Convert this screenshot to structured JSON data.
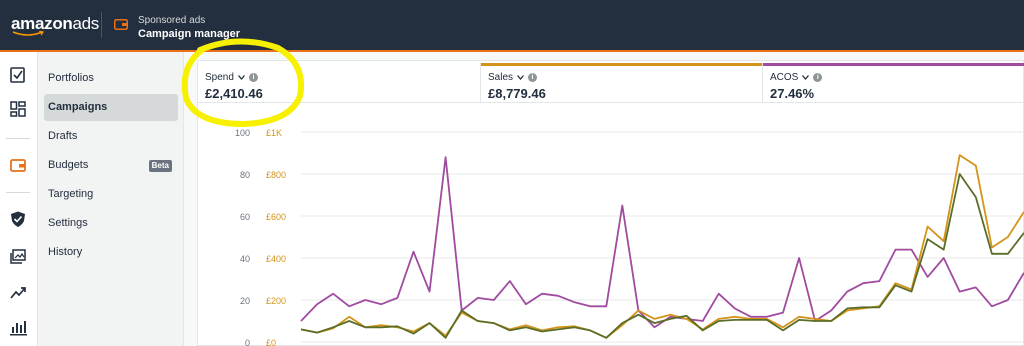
{
  "app": {
    "logo_main": "amazon",
    "logo_ads": "ads",
    "breadcrumb_top": "Sponsored ads",
    "breadcrumb_main": "Campaign manager"
  },
  "colors": {
    "topbar": "#232f3e",
    "accent": "#e8711a",
    "spend": "#5a6e28",
    "sales": "#d4931a",
    "acos": "#a04ba0",
    "highlight": "#f7f000"
  },
  "rail_icons": [
    "checklist-icon",
    "dashboard-icon",
    "wallet-icon",
    "shield-icon",
    "media-icon",
    "trend-icon",
    "bar-chart-icon"
  ],
  "sidebar": {
    "items": [
      {
        "label": "Portfolios",
        "active": false
      },
      {
        "label": "Campaigns",
        "active": true
      },
      {
        "label": "Drafts",
        "active": false
      },
      {
        "label": "Budgets",
        "active": false,
        "badge": "Beta"
      },
      {
        "label": "Targeting",
        "active": false
      },
      {
        "label": "Settings",
        "active": false
      },
      {
        "label": "History",
        "active": false
      }
    ]
  },
  "metrics": [
    {
      "label": "Spend",
      "value": "£2,410.46",
      "color": "#5a6e28"
    },
    {
      "label": "Sales",
      "value": "£8,779.46",
      "color": "#d4931a"
    },
    {
      "label": "ACOS",
      "value": "27.46%",
      "color": "#a04ba0"
    }
  ],
  "chart_data": {
    "type": "line",
    "left_axis": {
      "ticks": [
        "100",
        "80",
        "60",
        "40",
        "20",
        "0"
      ],
      "ylim": [
        0,
        100
      ]
    },
    "right_axis": {
      "ticks": [
        "£1K",
        "£800",
        "£600",
        "£400",
        "£200",
        "£0"
      ],
      "ylim": [
        0,
        1000
      ]
    },
    "grid": true,
    "series": [
      {
        "name": "ACOS",
        "color": "#a04ba0",
        "axis": "left",
        "values": [
          10,
          18,
          23,
          17,
          20,
          18,
          21,
          43,
          24,
          88,
          15,
          21,
          20,
          29,
          18,
          23,
          22,
          19,
          17,
          17,
          65,
          15,
          7,
          12,
          11,
          10,
          23,
          16,
          12,
          12,
          14,
          40,
          10,
          15,
          24,
          28,
          29,
          44,
          44,
          31,
          40,
          24,
          26,
          17,
          20,
          33
        ]
      },
      {
        "name": "Sales",
        "color": "#d4931a",
        "axis": "right",
        "values": [
          60,
          45,
          65,
          120,
          70,
          80,
          70,
          50,
          90,
          30,
          140,
          100,
          90,
          60,
          80,
          55,
          70,
          75,
          55,
          20,
          80,
          150,
          110,
          130,
          110,
          60,
          110,
          120,
          110,
          110,
          70,
          120,
          110,
          100,
          150,
          160,
          170,
          280,
          250,
          550,
          480,
          890,
          840,
          450,
          500,
          620
        ]
      },
      {
        "name": "Spend",
        "color": "#5a6e28",
        "axis": "right",
        "values": [
          60,
          45,
          70,
          100,
          70,
          70,
          75,
          40,
          90,
          20,
          150,
          100,
          90,
          55,
          70,
          50,
          60,
          70,
          55,
          20,
          90,
          130,
          90,
          110,
          125,
          55,
          100,
          105,
          105,
          105,
          55,
          105,
          100,
          100,
          160,
          165,
          165,
          270,
          240,
          490,
          440,
          800,
          690,
          420,
          420,
          520
        ]
      }
    ]
  }
}
